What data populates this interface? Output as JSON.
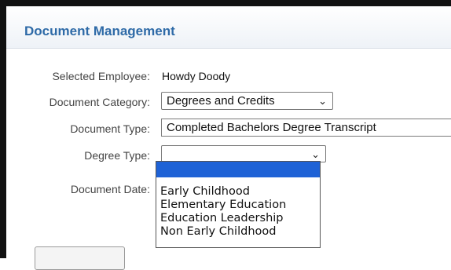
{
  "panel": {
    "title": "Document Management"
  },
  "form": {
    "selected_employee": {
      "label": "Selected Employee:",
      "value": "Howdy Doody"
    },
    "document_category": {
      "label": "Document Category:",
      "value": "Degrees and Credits"
    },
    "document_type": {
      "label": "Document Type:",
      "value": "Completed Bachelors Degree Transcript"
    },
    "degree_type": {
      "label": "Degree Type:",
      "value": "",
      "options": [
        "",
        "Early Childhood",
        "Elementary Education",
        "Education Leadership",
        "Non Early Childhood"
      ]
    },
    "document_date": {
      "label": "Document Date:"
    }
  },
  "colors": {
    "title": "#2e6aa7",
    "highlight": "#1e62d6"
  }
}
